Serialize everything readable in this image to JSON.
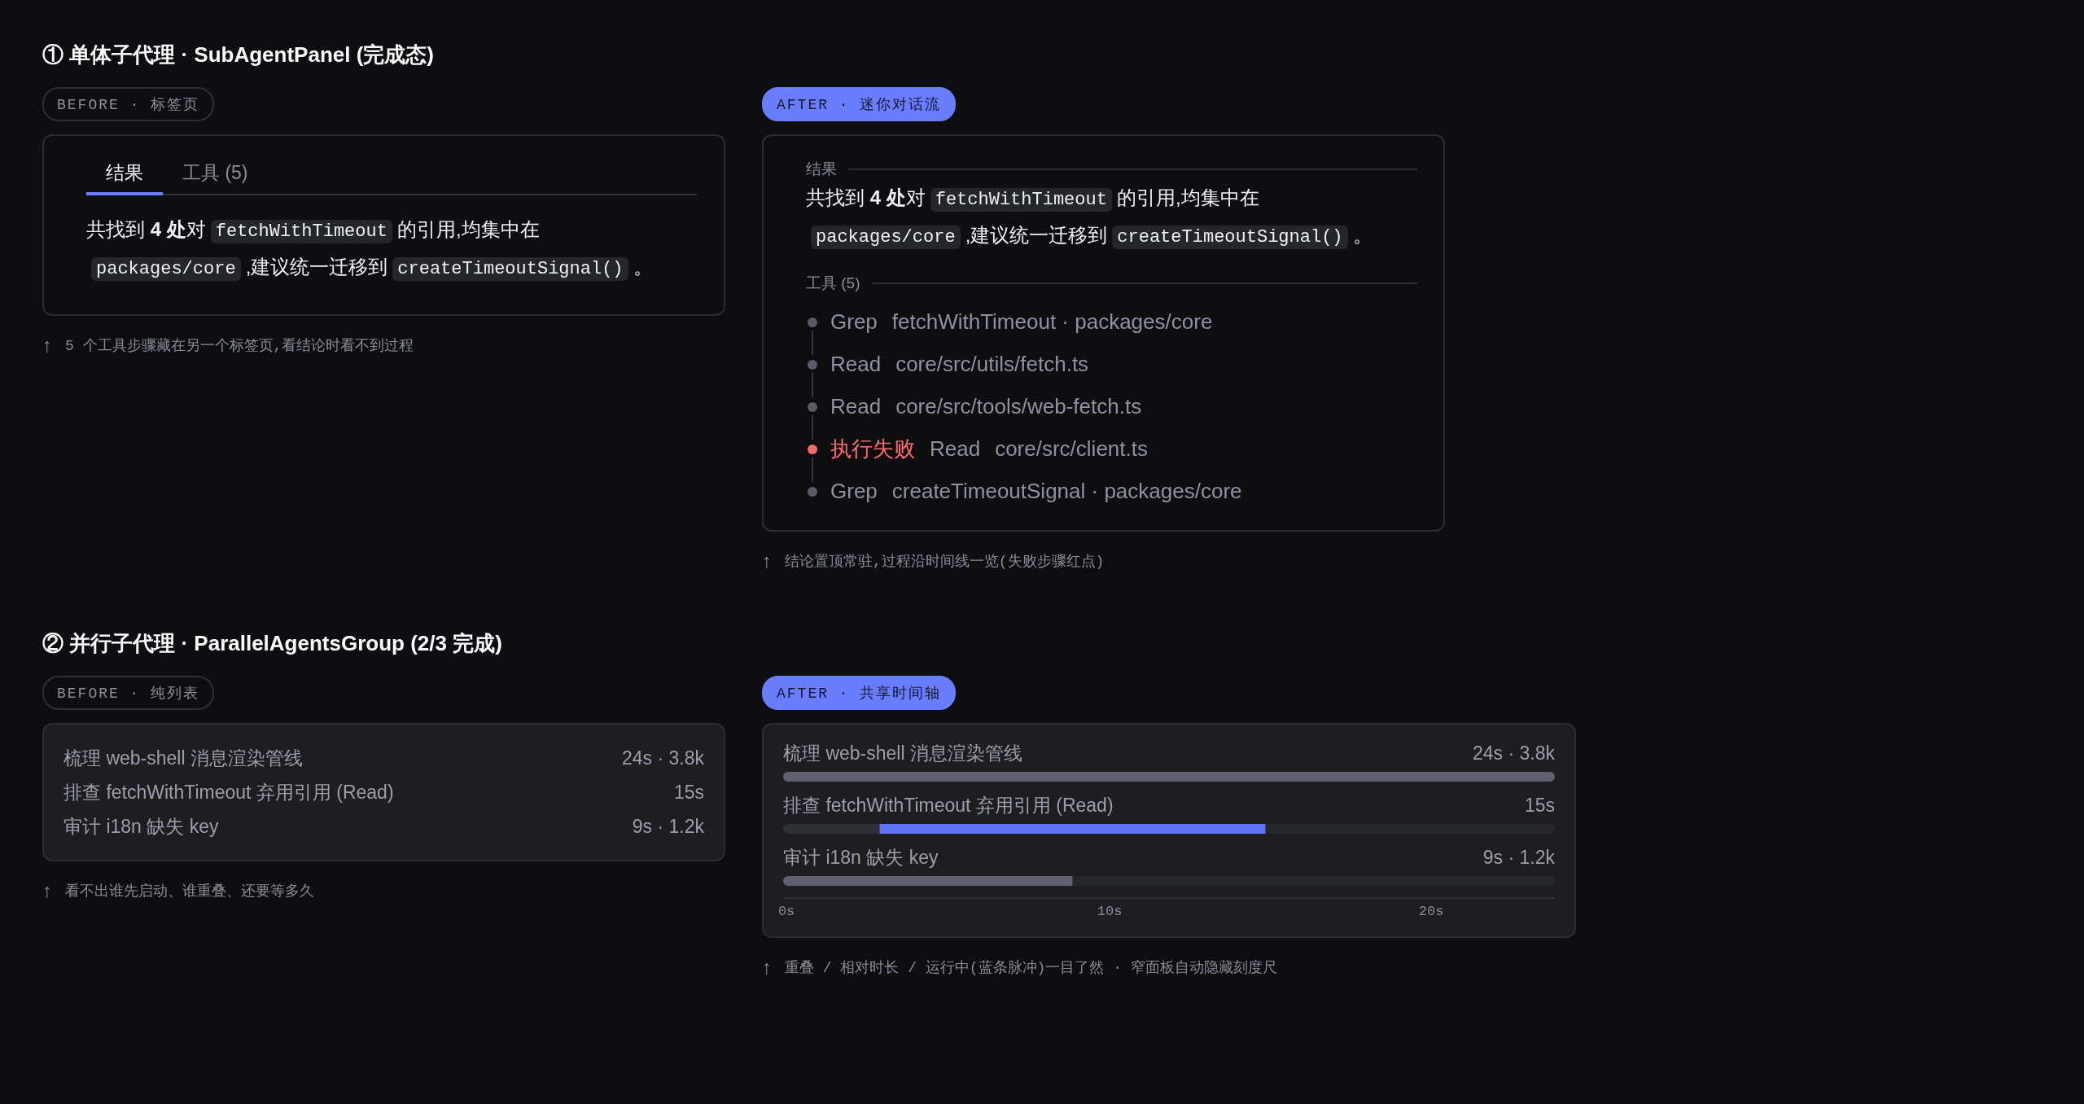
{
  "sections": [
    {
      "number": "①",
      "title": "单体子代理 · SubAgentPanel (完成态)",
      "before": {
        "badge": "BEFORE · 标签页",
        "tabs": [
          {
            "label": "结果",
            "selected": true
          },
          {
            "label": "工具 (5)",
            "selected": false
          }
        ],
        "paragraph": [
          {
            "kind": "text",
            "text": "共找到 **4 处**对"
          },
          {
            "kind": "code",
            "text": "fetchWithTimeout"
          },
          {
            "kind": "text",
            "text": "的引用,均集中在"
          },
          {
            "kind": "code",
            "text": "packages/core"
          },
          {
            "kind": "text",
            "text": ",建议统一迁移到"
          },
          {
            "kind": "code",
            "text": "createTimeoutSignal()"
          },
          {
            "kind": "text",
            "text": "。"
          }
        ],
        "caption": {
          "arrow": "↑",
          "text": "5 个工具步骤藏在另一个标签页,看结论时看不到过程"
        }
      },
      "after": {
        "badge": "AFTER · 迷你对话流",
        "result_label": "结果",
        "paragraph": [
          {
            "kind": "text",
            "text": "共找到 **4 处**对"
          },
          {
            "kind": "code",
            "text": "fetchWithTimeout"
          },
          {
            "kind": "text",
            "text": "的引用,均集中在"
          },
          {
            "kind": "code",
            "text": "packages/core"
          },
          {
            "kind": "text",
            "text": ",建议统一迁移到"
          },
          {
            "kind": "code",
            "text": "createTimeoutSignal()"
          },
          {
            "kind": "text",
            "text": "。"
          }
        ],
        "tools_label": "工具 (5)",
        "tools": [
          {
            "tool": "Grep",
            "target": "fetchWithTimeout · packages/core",
            "failed": false
          },
          {
            "tool": "Read",
            "target": "core/src/utils/fetch.ts",
            "failed": false
          },
          {
            "tool": "Read",
            "target": "core/src/tools/web-fetch.ts",
            "failed": false
          },
          {
            "tool": "Read",
            "target": "core/src/client.ts",
            "failed": true,
            "status": "执行失败"
          },
          {
            "tool": "Grep",
            "target": "createTimeoutSignal · packages/core",
            "failed": false
          }
        ],
        "caption": {
          "arrow": "↑",
          "text": "结论置顶常驻,过程沿时间线一览(失败步骤红点)"
        }
      }
    },
    {
      "number": "②",
      "title": "并行子代理 · ParallelAgentsGroup (2/3 完成)",
      "before": {
        "badge": "BEFORE · 纯列表",
        "rows": [
          {
            "title": "梳理 web-shell 消息渲染管线",
            "meta": "24s · 3.8k"
          },
          {
            "title": "排查 fetchWithTimeout 弃用引用 (Read)",
            "meta": "15s"
          },
          {
            "title": "审计 i18n 缺失 key",
            "meta": "9s · 1.2k"
          }
        ],
        "caption": {
          "arrow": "↑",
          "text": "看不出谁先启动、谁重叠、还要等多久"
        }
      },
      "after": {
        "badge": "AFTER · 共享时间轴",
        "rows": [
          {
            "meta": "24s · 3.8k"
          },
          {
            "meta": "15s"
          },
          {
            "meta": "9s · 1.2k"
          }
        ],
        "chart_data": {
          "type": "bar",
          "orientation": "horizontal",
          "stacked": true,
          "categories": [
            "梳理 web-shell 消息渲染管线",
            "排查 fetchWithTimeout 弃用引用 (Read)",
            "审计 i18n 缺失 key"
          ],
          "series": [
            {
              "color": "#2e2f35",
              "values": [
                0,
                3,
                0
              ]
            },
            {
              "color": "#5f6170",
              "values": [
                24,
                0,
                9
              ]
            },
            {
              "color": "#5f74f2",
              "values": [
                0,
                12,
                0
              ]
            }
          ],
          "xlim": [
            0,
            24
          ],
          "xticks": [
            {
              "value": 0,
              "label": "0s"
            },
            {
              "value": 10,
              "label": "10s"
            },
            {
              "value": 20,
              "label": "20s"
            }
          ]
        },
        "caption": {
          "arrow": "↑",
          "text": "重叠 / 相对时长 / 运行中(蓝条脉冲)一目了然 · 窄面板自动隐藏刻度尺"
        }
      }
    }
  ]
}
